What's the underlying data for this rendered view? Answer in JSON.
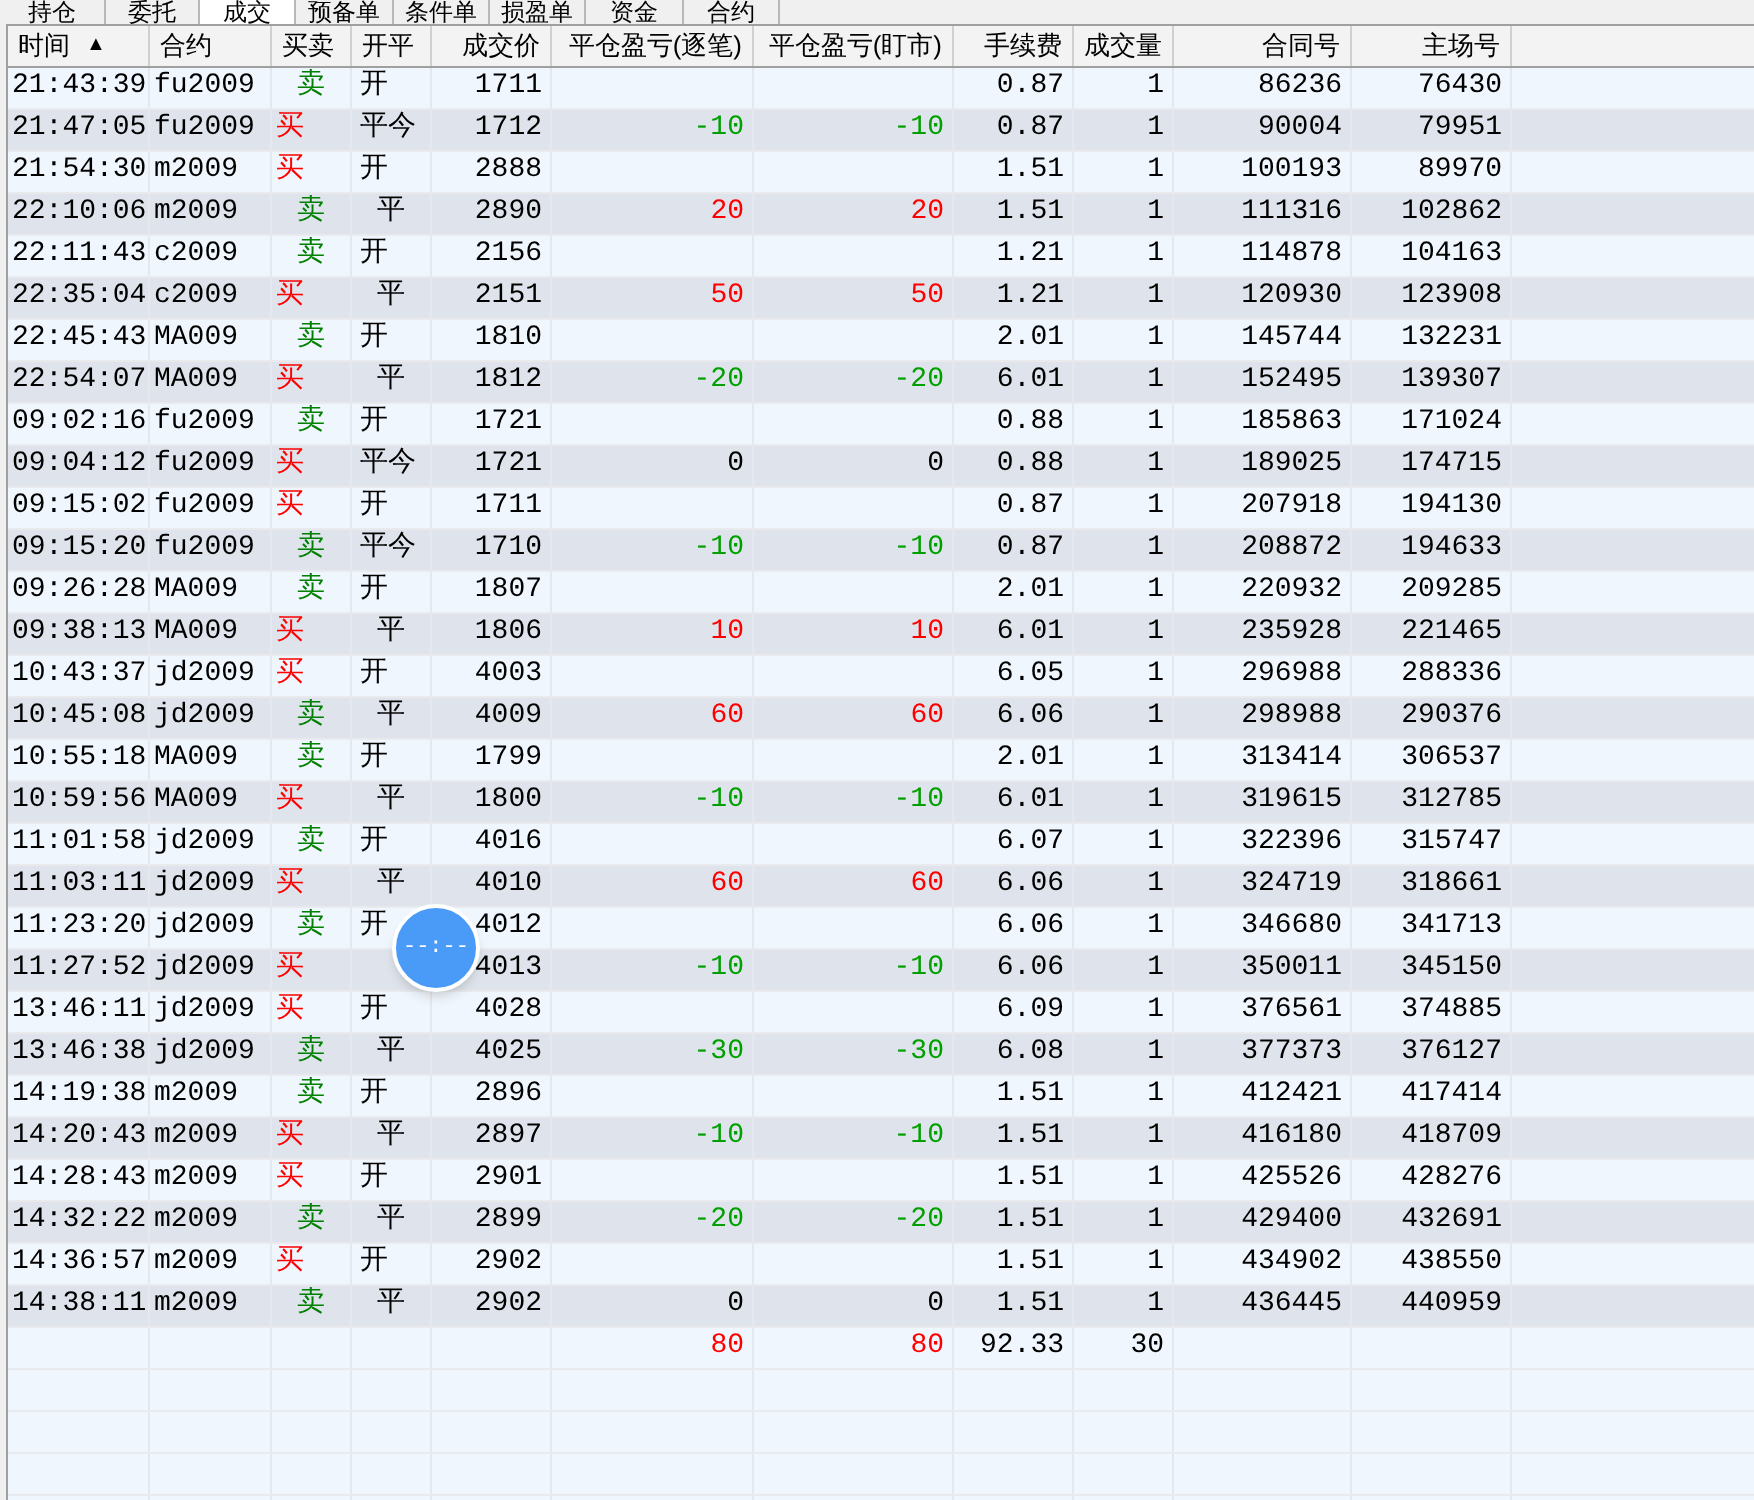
{
  "tabs": [
    {
      "label": "持仓",
      "selected": false
    },
    {
      "label": "委托",
      "selected": false
    },
    {
      "label": "成交",
      "selected": true
    },
    {
      "label": "预备单",
      "selected": false
    },
    {
      "label": "条件单",
      "selected": false
    },
    {
      "label": "损盈单",
      "selected": false
    },
    {
      "label": "资金",
      "selected": false
    },
    {
      "label": "合约",
      "selected": false
    }
  ],
  "table": {
    "columns": [
      {
        "label": "时间",
        "sort_mark": "▲"
      },
      {
        "label": "合约"
      },
      {
        "label": "买卖"
      },
      {
        "label": "开平"
      },
      {
        "label": "成交价"
      },
      {
        "label": "平仓盈亏(逐笔)"
      },
      {
        "label": "平仓盈亏(盯市)"
      },
      {
        "label": "手续费"
      },
      {
        "label": "成交量"
      },
      {
        "label": "合同号"
      },
      {
        "label": "主场号"
      }
    ],
    "rows": [
      {
        "time": "21:43:39",
        "contract": "fu2009",
        "side": {
          "text": "卖",
          "color": "#008000"
        },
        "offset": {
          "text": "开",
          "centered": false
        },
        "price": "1711",
        "fee": "0.87",
        "qty": "1",
        "contract_no": "86236",
        "main_no": "76430"
      },
      {
        "time": "21:47:05",
        "contract": "fu2009",
        "side": {
          "text": "买",
          "color": "#ff0000"
        },
        "offset": {
          "text": "平今",
          "centered": false
        },
        "price": "1712",
        "pnl_trade": {
          "text": "-10",
          "color": "#00a000"
        },
        "pnl_mark": {
          "text": "-10",
          "color": "#00a000"
        },
        "fee": "0.87",
        "qty": "1",
        "contract_no": "90004",
        "main_no": "79951"
      },
      {
        "time": "21:54:30",
        "contract": "m2009",
        "side": {
          "text": "买",
          "color": "#ff0000"
        },
        "offset": {
          "text": "开",
          "centered": false
        },
        "price": "2888",
        "fee": "1.51",
        "qty": "1",
        "contract_no": "100193",
        "main_no": "89970"
      },
      {
        "time": "22:10:06",
        "contract": "m2009",
        "side": {
          "text": "卖",
          "color": "#008000"
        },
        "offset": {
          "text": "平",
          "centered": true
        },
        "price": "2890",
        "pnl_trade": {
          "text": "20",
          "color": "#ff0000"
        },
        "pnl_mark": {
          "text": "20",
          "color": "#ff0000"
        },
        "fee": "1.51",
        "qty": "1",
        "contract_no": "111316",
        "main_no": "102862"
      },
      {
        "time": "22:11:43",
        "contract": "c2009",
        "side": {
          "text": "卖",
          "color": "#008000"
        },
        "offset": {
          "text": "开",
          "centered": false
        },
        "price": "2156",
        "fee": "1.21",
        "qty": "1",
        "contract_no": "114878",
        "main_no": "104163"
      },
      {
        "time": "22:35:04",
        "contract": "c2009",
        "side": {
          "text": "买",
          "color": "#ff0000"
        },
        "offset": {
          "text": "平",
          "centered": true
        },
        "price": "2151",
        "pnl_trade": {
          "text": "50",
          "color": "#ff0000"
        },
        "pnl_mark": {
          "text": "50",
          "color": "#ff0000"
        },
        "fee": "1.21",
        "qty": "1",
        "contract_no": "120930",
        "main_no": "123908"
      },
      {
        "time": "22:45:43",
        "contract": "MA009",
        "side": {
          "text": "卖",
          "color": "#008000"
        },
        "offset": {
          "text": "开",
          "centered": false
        },
        "price": "1810",
        "fee": "2.01",
        "qty": "1",
        "contract_no": "145744",
        "main_no": "132231"
      },
      {
        "time": "22:54:07",
        "contract": "MA009",
        "side": {
          "text": "买",
          "color": "#ff0000"
        },
        "offset": {
          "text": "平",
          "centered": true
        },
        "price": "1812",
        "pnl_trade": {
          "text": "-20",
          "color": "#00a000"
        },
        "pnl_mark": {
          "text": "-20",
          "color": "#00a000"
        },
        "fee": "6.01",
        "qty": "1",
        "contract_no": "152495",
        "main_no": "139307"
      },
      {
        "time": "09:02:16",
        "contract": "fu2009",
        "side": {
          "text": "卖",
          "color": "#008000"
        },
        "offset": {
          "text": "开",
          "centered": false
        },
        "price": "1721",
        "fee": "0.88",
        "qty": "1",
        "contract_no": "185863",
        "main_no": "171024"
      },
      {
        "time": "09:04:12",
        "contract": "fu2009",
        "side": {
          "text": "买",
          "color": "#ff0000"
        },
        "offset": {
          "text": "平今",
          "centered": false
        },
        "price": "1721",
        "pnl_trade": {
          "text": "0",
          "color": "#000000"
        },
        "pnl_mark": {
          "text": "0",
          "color": "#000000"
        },
        "fee": "0.88",
        "qty": "1",
        "contract_no": "189025",
        "main_no": "174715"
      },
      {
        "time": "09:15:02",
        "contract": "fu2009",
        "side": {
          "text": "买",
          "color": "#ff0000"
        },
        "offset": {
          "text": "开",
          "centered": false
        },
        "price": "1711",
        "fee": "0.87",
        "qty": "1",
        "contract_no": "207918",
        "main_no": "194130"
      },
      {
        "time": "09:15:20",
        "contract": "fu2009",
        "side": {
          "text": "卖",
          "color": "#008000"
        },
        "offset": {
          "text": "平今",
          "centered": false
        },
        "price": "1710",
        "pnl_trade": {
          "text": "-10",
          "color": "#00a000"
        },
        "pnl_mark": {
          "text": "-10",
          "color": "#00a000"
        },
        "fee": "0.87",
        "qty": "1",
        "contract_no": "208872",
        "main_no": "194633"
      },
      {
        "time": "09:26:28",
        "contract": "MA009",
        "side": {
          "text": "卖",
          "color": "#008000"
        },
        "offset": {
          "text": "开",
          "centered": false
        },
        "price": "1807",
        "fee": "2.01",
        "qty": "1",
        "contract_no": "220932",
        "main_no": "209285"
      },
      {
        "time": "09:38:13",
        "contract": "MA009",
        "side": {
          "text": "买",
          "color": "#ff0000"
        },
        "offset": {
          "text": "平",
          "centered": true
        },
        "price": "1806",
        "pnl_trade": {
          "text": "10",
          "color": "#ff0000"
        },
        "pnl_mark": {
          "text": "10",
          "color": "#ff0000"
        },
        "fee": "6.01",
        "qty": "1",
        "contract_no": "235928",
        "main_no": "221465"
      },
      {
        "time": "10:43:37",
        "contract": "jd2009",
        "side": {
          "text": "买",
          "color": "#ff0000"
        },
        "offset": {
          "text": "开",
          "centered": false
        },
        "price": "4003",
        "fee": "6.05",
        "qty": "1",
        "contract_no": "296988",
        "main_no": "288336"
      },
      {
        "time": "10:45:08",
        "contract": "jd2009",
        "side": {
          "text": "卖",
          "color": "#008000"
        },
        "offset": {
          "text": "平",
          "centered": true
        },
        "price": "4009",
        "pnl_trade": {
          "text": "60",
          "color": "#ff0000"
        },
        "pnl_mark": {
          "text": "60",
          "color": "#ff0000"
        },
        "fee": "6.06",
        "qty": "1",
        "contract_no": "298988",
        "main_no": "290376"
      },
      {
        "time": "10:55:18",
        "contract": "MA009",
        "side": {
          "text": "卖",
          "color": "#008000"
        },
        "offset": {
          "text": "开",
          "centered": false
        },
        "price": "1799",
        "fee": "2.01",
        "qty": "1",
        "contract_no": "313414",
        "main_no": "306537"
      },
      {
        "time": "10:59:56",
        "contract": "MA009",
        "side": {
          "text": "买",
          "color": "#ff0000"
        },
        "offset": {
          "text": "平",
          "centered": true
        },
        "price": "1800",
        "pnl_trade": {
          "text": "-10",
          "color": "#00a000"
        },
        "pnl_mark": {
          "text": "-10",
          "color": "#00a000"
        },
        "fee": "6.01",
        "qty": "1",
        "contract_no": "319615",
        "main_no": "312785"
      },
      {
        "time": "11:01:58",
        "contract": "jd2009",
        "side": {
          "text": "卖",
          "color": "#008000"
        },
        "offset": {
          "text": "开",
          "centered": false
        },
        "price": "4016",
        "fee": "6.07",
        "qty": "1",
        "contract_no": "322396",
        "main_no": "315747"
      },
      {
        "time": "11:03:11",
        "contract": "jd2009",
        "side": {
          "text": "买",
          "color": "#ff0000"
        },
        "offset": {
          "text": "平",
          "centered": true
        },
        "price": "4010",
        "pnl_trade": {
          "text": "60",
          "color": "#ff0000"
        },
        "pnl_mark": {
          "text": "60",
          "color": "#ff0000"
        },
        "fee": "6.06",
        "qty": "1",
        "contract_no": "324719",
        "main_no": "318661"
      },
      {
        "time": "11:23:20",
        "contract": "jd2009",
        "side": {
          "text": "卖",
          "color": "#008000"
        },
        "offset": {
          "text": "开",
          "centered": false
        },
        "price": "4012",
        "fee": "6.06",
        "qty": "1",
        "contract_no": "346680",
        "main_no": "341713"
      },
      {
        "time": "11:27:52",
        "contract": "jd2009",
        "side": {
          "text": "买",
          "color": "#ff0000"
        },
        "price": "4013",
        "pnl_trade": {
          "text": "-10",
          "color": "#00a000"
        },
        "pnl_mark": {
          "text": "-10",
          "color": "#00a000"
        },
        "fee": "6.06",
        "qty": "1",
        "contract_no": "350011",
        "main_no": "345150"
      },
      {
        "time": "13:46:11",
        "contract": "jd2009",
        "side": {
          "text": "买",
          "color": "#ff0000"
        },
        "offset": {
          "text": "开",
          "centered": false
        },
        "price": "4028",
        "fee": "6.09",
        "qty": "1",
        "contract_no": "376561",
        "main_no": "374885"
      },
      {
        "time": "13:46:38",
        "contract": "jd2009",
        "side": {
          "text": "卖",
          "color": "#008000"
        },
        "offset": {
          "text": "平",
          "centered": true
        },
        "price": "4025",
        "pnl_trade": {
          "text": "-30",
          "color": "#00a000"
        },
        "pnl_mark": {
          "text": "-30",
          "color": "#00a000"
        },
        "fee": "6.08",
        "qty": "1",
        "contract_no": "377373",
        "main_no": "376127"
      },
      {
        "time": "14:19:38",
        "contract": "m2009",
        "side": {
          "text": "卖",
          "color": "#008000"
        },
        "offset": {
          "text": "开",
          "centered": false
        },
        "price": "2896",
        "fee": "1.51",
        "qty": "1",
        "contract_no": "412421",
        "main_no": "417414"
      },
      {
        "time": "14:20:43",
        "contract": "m2009",
        "side": {
          "text": "买",
          "color": "#ff0000"
        },
        "offset": {
          "text": "平",
          "centered": true
        },
        "price": "2897",
        "pnl_trade": {
          "text": "-10",
          "color": "#00a000"
        },
        "pnl_mark": {
          "text": "-10",
          "color": "#00a000"
        },
        "fee": "1.51",
        "qty": "1",
        "contract_no": "416180",
        "main_no": "418709"
      },
      {
        "time": "14:28:43",
        "contract": "m2009",
        "side": {
          "text": "买",
          "color": "#ff0000"
        },
        "offset": {
          "text": "开",
          "centered": false
        },
        "price": "2901",
        "fee": "1.51",
        "qty": "1",
        "contract_no": "425526",
        "main_no": "428276"
      },
      {
        "time": "14:32:22",
        "contract": "m2009",
        "side": {
          "text": "卖",
          "color": "#008000"
        },
        "offset": {
          "text": "平",
          "centered": true
        },
        "price": "2899",
        "pnl_trade": {
          "text": "-20",
          "color": "#00a000"
        },
        "pnl_mark": {
          "text": "-20",
          "color": "#00a000"
        },
        "fee": "1.51",
        "qty": "1",
        "contract_no": "429400",
        "main_no": "432691"
      },
      {
        "time": "14:36:57",
        "contract": "m2009",
        "side": {
          "text": "买",
          "color": "#ff0000"
        },
        "offset": {
          "text": "开",
          "centered": false
        },
        "price": "2902",
        "fee": "1.51",
        "qty": "1",
        "contract_no": "434902",
        "main_no": "438550"
      },
      {
        "time": "14:38:11",
        "contract": "m2009",
        "side": {
          "text": "卖",
          "color": "#008000"
        },
        "offset": {
          "text": "平",
          "centered": true
        },
        "price": "2902",
        "pnl_trade": {
          "text": "0",
          "color": "#000000"
        },
        "pnl_mark": {
          "text": "0",
          "color": "#000000"
        },
        "fee": "1.51",
        "qty": "1",
        "contract_no": "436445",
        "main_no": "440959"
      }
    ],
    "totals": {
      "pnl_trade": {
        "text": "80",
        "color": "#ff0000"
      },
      "pnl_mark": {
        "text": "80",
        "color": "#ff0000"
      },
      "fee": "92.33",
      "qty": "30"
    }
  },
  "floating_widget": {
    "text": "--:--"
  }
}
